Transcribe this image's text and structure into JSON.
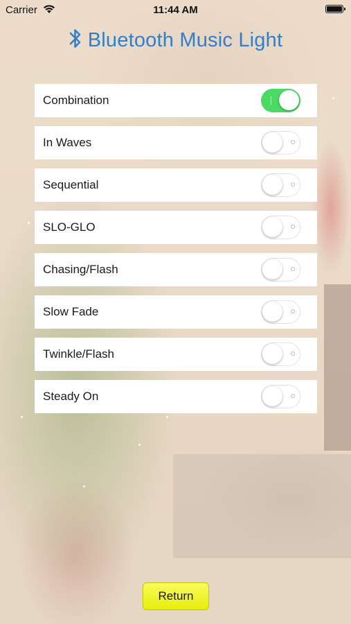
{
  "status_bar": {
    "carrier": "Carrier",
    "time": "11:44 AM",
    "wifi_icon": "wifi-icon",
    "battery_icon": "battery-icon"
  },
  "header": {
    "title": "Bluetooth Music Light",
    "icon": "bluetooth-icon",
    "color": "#2f7fcf"
  },
  "modes": [
    {
      "label": "Combination",
      "on": true
    },
    {
      "label": "In Waves",
      "on": false
    },
    {
      "label": "Sequential",
      "on": false
    },
    {
      "label": "SLO-GLO",
      "on": false
    },
    {
      "label": "Chasing/Flash",
      "on": false
    },
    {
      "label": "Slow Fade",
      "on": false
    },
    {
      "label": "Twinkle/Flash",
      "on": false
    },
    {
      "label": "Steady On",
      "on": false
    }
  ],
  "toggle_on_color": "#4cd964",
  "return_button": {
    "label": "Return",
    "color": "#eef21a"
  }
}
